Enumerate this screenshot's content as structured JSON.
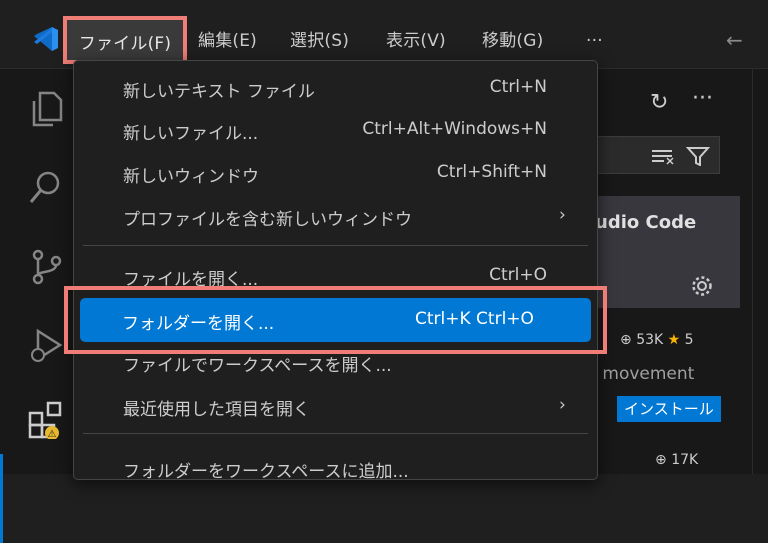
{
  "menubar": {
    "items": [
      "ファイル(F)",
      "編集(E)",
      "選択(S)",
      "表示(V)",
      "移動(G)",
      "···"
    ]
  },
  "file_menu": {
    "items": [
      {
        "label": "新しいテキスト ファイル",
        "shortcut": "Ctrl+N"
      },
      {
        "label": "新しいファイル...",
        "shortcut": "Ctrl+Alt+Windows+N"
      },
      {
        "label": "新しいウィンドウ",
        "shortcut": "Ctrl+Shift+N"
      },
      {
        "label": "プロファイルを含む新しいウィンドウ",
        "shortcut": "",
        "submenu": true
      },
      {
        "label": "ファイルを開く...",
        "shortcut": "Ctrl+O"
      },
      {
        "label": "フォルダーを開く...",
        "shortcut": "Ctrl+K Ctrl+O",
        "highlighted": true
      },
      {
        "label": "ファイルでワークスペースを開く...",
        "shortcut": ""
      },
      {
        "label": "最近使用した項目を開く",
        "shortcut": "",
        "submenu": true
      },
      {
        "label": "フォルダーをワークスペースに追加...",
        "shortcut": ""
      }
    ]
  },
  "extension_panel": {
    "title_partial": "udio Code",
    "downloads": "53K",
    "rating": "5",
    "description_partial": "r movement",
    "install_label": "インストール",
    "downloads2": "17K"
  },
  "colors": {
    "accent": "#0078d4",
    "highlight_outline": "#f07d76"
  }
}
